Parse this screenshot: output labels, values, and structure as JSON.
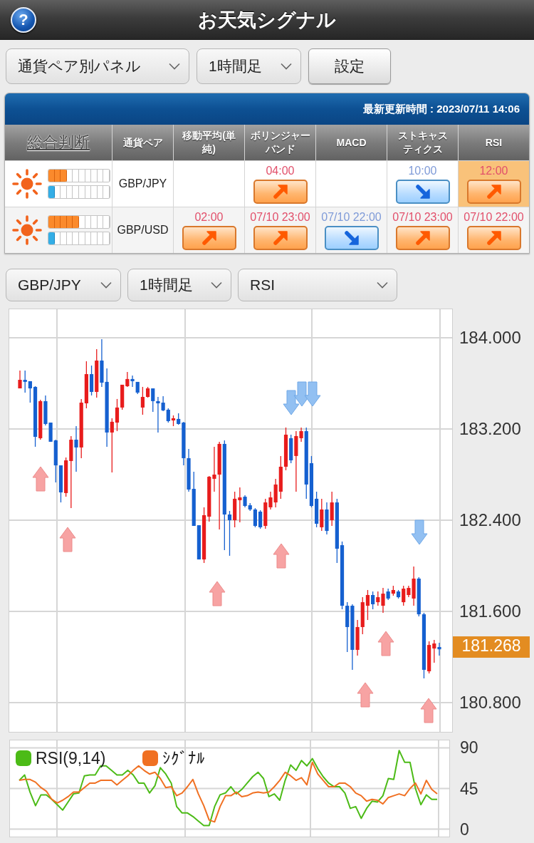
{
  "header": {
    "help_label": "?",
    "title": "お天気シグナル"
  },
  "toolbar": {
    "selects": [
      {
        "value": "通貨ペア別パネル"
      },
      {
        "value": "1時間足"
      }
    ],
    "button": "設定"
  },
  "signal_panel": {
    "updated": "最新更新時間 : 2023/07/11 14:06",
    "columns": [
      {
        "label": "総合判断",
        "kind": "link"
      },
      {
        "label": "通貨ペア",
        "kind": "plain"
      },
      {
        "label": "移動平均(単純)",
        "kind": "plain"
      },
      {
        "label": "ボリンジャーバンド",
        "kind": "plain"
      },
      {
        "label": "MACD",
        "kind": "plain"
      },
      {
        "label": "ストキャスティクス",
        "kind": "plain"
      },
      {
        "label": "RSI",
        "kind": "plain"
      }
    ],
    "rows": [
      {
        "weather": {
          "kind": "sunny"
        },
        "meters": [
          {
            "kind": "buy",
            "level": 0.3
          },
          {
            "kind": "sell",
            "level": 0.1
          }
        ],
        "pair": "GBP/JPY",
        "signals": {
          "bollinger_bands": {
            "time": "04:00",
            "kind": "buy",
            "highlighted": false
          },
          "stochastics": {
            "time": "10:00",
            "kind": "sell",
            "highlighted": false
          },
          "rsi": {
            "time": "12:00",
            "kind": "buy",
            "highlighted": true
          }
        }
      },
      {
        "weather": {
          "kind": "sunny"
        },
        "meters": [
          {
            "kind": "buy",
            "level": 0.5
          },
          {
            "kind": "sell",
            "level": 0.1
          }
        ],
        "pair": "GBP/USD",
        "signals": {
          "moving_average": {
            "time": "02:00",
            "kind": "buy",
            "highlighted": false
          },
          "bollinger_bands": {
            "time": "07/10 23:00",
            "kind": "buy",
            "highlighted": false
          },
          "macd": {
            "time": "07/10 22:00",
            "kind": "sell",
            "highlighted": false
          },
          "stochastics": {
            "time": "07/10 23:00",
            "kind": "buy",
            "highlighted": false
          },
          "rsi": {
            "time": "07/10 22:00",
            "kind": "buy",
            "highlighted": false
          }
        }
      }
    ]
  },
  "chart_controls": {
    "selects": [
      {
        "value": "GBP/JPY"
      },
      {
        "value": "1時間足"
      },
      {
        "value": "RSI"
      }
    ]
  },
  "price_chart": {
    "chart_data": {
      "type": "candlestick",
      "categories": [
        null,
        null,
        null,
        null,
        null,
        null,
        null,
        null,
        null,
        null,
        null,
        null,
        null,
        null,
        null,
        null,
        null,
        null,
        null,
        null,
        null,
        null,
        null,
        null,
        null,
        null,
        null,
        null,
        null,
        null,
        null,
        null,
        null,
        null,
        null,
        null,
        null,
        null,
        null,
        null,
        null,
        null,
        null,
        null,
        null,
        null,
        null,
        null,
        null,
        null,
        null,
        null,
        null,
        null,
        null,
        null,
        null,
        null,
        null,
        null,
        null,
        null,
        null,
        null,
        null,
        null,
        null,
        null,
        null,
        null,
        null,
        null,
        null,
        null,
        null,
        null,
        null,
        null,
        null,
        null,
        null,
        null,
        null
      ],
      "ohlc": [
        [
          183.556,
          183.713,
          183.556,
          183.631
        ],
        [
          183.631,
          183.713,
          183.519,
          183.613
        ],
        [
          183.619,
          183.619,
          183.431,
          183.556
        ],
        [
          183.569,
          183.575,
          183.044,
          183.131
        ],
        [
          183.119,
          183.456,
          183.106,
          183.444
        ],
        [
          183.444,
          183.494,
          183.231,
          183.244
        ],
        [
          183.256,
          183.256,
          183.088,
          183.088
        ],
        [
          183.1,
          183.106,
          182.731,
          182.881
        ],
        [
          182.881,
          182.881,
          182.556,
          182.644
        ],
        [
          182.638,
          182.95,
          182.606,
          182.925
        ],
        [
          182.919,
          183.138,
          182.506,
          183.106
        ],
        [
          183.106,
          183.225,
          182.825,
          183.038
        ],
        [
          183.038,
          183.463,
          182.944,
          183.431
        ],
        [
          183.425,
          183.794,
          183.381,
          183.681
        ],
        [
          183.681,
          183.756,
          183.494,
          183.525
        ],
        [
          183.525,
          183.9,
          183.475,
          183.8
        ],
        [
          183.8,
          183.988,
          183.569,
          183.606
        ],
        [
          183.613,
          183.731,
          183.044,
          183.169
        ],
        [
          183.169,
          183.294,
          182.819,
          183.263
        ],
        [
          183.256,
          183.463,
          183.181,
          183.388
        ],
        [
          183.388,
          183.588,
          183.369,
          183.588
        ],
        [
          183.575,
          183.7,
          183.569,
          183.638
        ],
        [
          183.638,
          183.669,
          183.569,
          183.619
        ],
        [
          183.613,
          183.613,
          183.506,
          183.519
        ],
        [
          183.388,
          183.569,
          183.325,
          183.481
        ],
        [
          183.481,
          183.569,
          183.475,
          183.556
        ],
        [
          183.556,
          183.556,
          183.35,
          183.444
        ],
        [
          183.444,
          183.481,
          183.169,
          183.425
        ],
        [
          183.431,
          183.488,
          183.356,
          183.363
        ],
        [
          183.369,
          183.381,
          183.256,
          183.269
        ],
        [
          183.275,
          183.319,
          183.225,
          183.294
        ],
        [
          183.288,
          183.338,
          183.238,
          183.244
        ],
        [
          183.256,
          183.263,
          182.881,
          182.944
        ],
        [
          182.944,
          183.025,
          182.65,
          182.669
        ],
        [
          182.675,
          182.825,
          182.35,
          182.35
        ],
        [
          182.356,
          182.356,
          182.056,
          182.056
        ],
        [
          182.056,
          182.513,
          182.025,
          182.444
        ],
        [
          182.431,
          182.788,
          182.388,
          182.781
        ],
        [
          182.763,
          183.044,
          182.65,
          182.8
        ],
        [
          182.8,
          183.088,
          182.319,
          183.069
        ],
        [
          183.069,
          183.1,
          182.138,
          182.45
        ],
        [
          182.45,
          182.481,
          182.088,
          182.4
        ],
        [
          182.4,
          182.65,
          182.338,
          182.588
        ],
        [
          182.575,
          182.688,
          182.381,
          182.6
        ],
        [
          182.606,
          182.619,
          182.513,
          182.525
        ],
        [
          182.531,
          182.55,
          182.481,
          182.494
        ],
        [
          182.494,
          182.506,
          182.338,
          182.35
        ],
        [
          182.475,
          182.488,
          182.325,
          182.338
        ],
        [
          182.35,
          182.588,
          182.325,
          182.556
        ],
        [
          182.513,
          182.65,
          182.494,
          182.6
        ],
        [
          182.556,
          182.763,
          182.513,
          182.713
        ],
        [
          182.65,
          182.963,
          182.588,
          182.869
        ],
        [
          182.869,
          183.213,
          182.838,
          183.15
        ],
        [
          183.119,
          183.15,
          182.9,
          182.925
        ],
        [
          182.963,
          183.181,
          182.65,
          183.138
        ],
        [
          183.119,
          183.213,
          183.088,
          183.181
        ],
        [
          183.181,
          183.213,
          182.588,
          182.713
        ],
        [
          182.9,
          182.963,
          182.513,
          182.525
        ],
        [
          182.588,
          182.65,
          182.338,
          182.369
        ],
        [
          182.338,
          182.588,
          182.306,
          182.494
        ],
        [
          182.494,
          182.556,
          182.275,
          182.306
        ],
        [
          182.4,
          182.65,
          182.35,
          182.556
        ],
        [
          182.556,
          182.588,
          182.025,
          182.15
        ],
        [
          182.181,
          182.213,
          181.619,
          181.65
        ],
        [
          181.65,
          181.681,
          181.244,
          181.463
        ],
        [
          181.65,
          181.663,
          181.088,
          181.263
        ],
        [
          181.263,
          181.525,
          181.213,
          181.463
        ],
        [
          181.463,
          181.725,
          181.4,
          181.681
        ],
        [
          181.65,
          181.788,
          181.525,
          181.744
        ],
        [
          181.744,
          181.775,
          181.619,
          181.663
        ],
        [
          181.681,
          181.775,
          181.65,
          181.725
        ],
        [
          181.65,
          181.806,
          181.588,
          181.756
        ],
        [
          181.775,
          181.8,
          181.7,
          181.713
        ],
        [
          181.756,
          181.825,
          181.738,
          181.788
        ],
        [
          181.775,
          181.788,
          181.713,
          181.725
        ],
        [
          181.681,
          181.825,
          181.65,
          181.8
        ],
        [
          181.744,
          181.825,
          181.725,
          181.806
        ],
        [
          181.713,
          181.994,
          181.65,
          181.888
        ],
        [
          181.888,
          181.9,
          181.556,
          181.575
        ],
        [
          181.575,
          181.588,
          181.013,
          181.088
        ],
        [
          181.075,
          181.338,
          181.056,
          181.306
        ],
        [
          181.275,
          181.35,
          181.15,
          181.319
        ],
        [
          181.288,
          181.325,
          181.213,
          181.268
        ]
      ],
      "ylim": [
        180.538,
        184.256
      ],
      "yticks": [
        {
          "value": 184,
          "label": "184.000"
        },
        {
          "value": 183.2,
          "label": "183.200"
        },
        {
          "value": 182.4,
          "label": "182.400"
        },
        {
          "value": 181.6,
          "label": "181.600"
        },
        {
          "value": 180.8,
          "label": "180.800"
        }
      ],
      "grid": true
    },
    "current_price": "181.268"
  },
  "rsi_chart": {
    "chart_data": {
      "type": "line",
      "ylim": [
        -9,
        99
      ],
      "yticks": [
        0,
        45,
        90
      ],
      "grid": true,
      "legend": "top-left",
      "series": [
        {
          "name": "RSI(9,14)",
          "color": "#4cbb17",
          "values": [
            54,
            60,
            41,
            26,
            38,
            38,
            33,
            27,
            21,
            30,
            39,
            40,
            59,
            60,
            60,
            70,
            70,
            65,
            60,
            60,
            65,
            60,
            51,
            51,
            40,
            48,
            68,
            61,
            51,
            25,
            18,
            18,
            14,
            9,
            4,
            4,
            25,
            38,
            40,
            47,
            39,
            44,
            51,
            58,
            63,
            56,
            36,
            39,
            32,
            54,
            71,
            65,
            76,
            70,
            78,
            67,
            58,
            51,
            47,
            47,
            40,
            23,
            25,
            12,
            23,
            31,
            30,
            37,
            56,
            55,
            87,
            74,
            74,
            45,
            27,
            38,
            33,
            33
          ]
        },
        {
          "name": "ｼｸﾞﾅﾙ",
          "color": "#f07022",
          "values": [
            54,
            55,
            55,
            52,
            46,
            42,
            33,
            29,
            32,
            36,
            41,
            41,
            46,
            51,
            51,
            54,
            54,
            54,
            49,
            54,
            59,
            65,
            70,
            65,
            61,
            63,
            56,
            46,
            47,
            37,
            40,
            47,
            55,
            39,
            26,
            10,
            8,
            25,
            37,
            37,
            41,
            36,
            37,
            40,
            41,
            40,
            41,
            47,
            54,
            63,
            59,
            54,
            57,
            49,
            74,
            61,
            54,
            47,
            47,
            51,
            51,
            47,
            40,
            37,
            31,
            33,
            32,
            28,
            35,
            37,
            39,
            37,
            45,
            51,
            39,
            54,
            44,
            39
          ]
        }
      ]
    }
  }
}
